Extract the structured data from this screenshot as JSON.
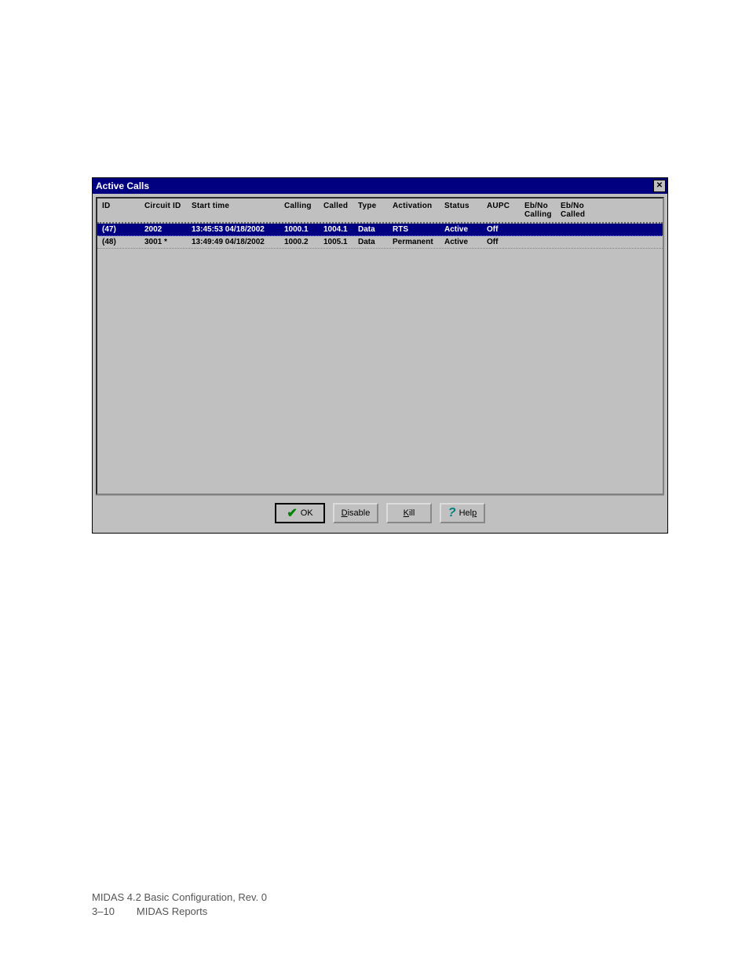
{
  "window": {
    "title": "Active Calls"
  },
  "table": {
    "headers": {
      "id": "ID",
      "circuit_id": "Circuit ID",
      "start_time": "Start time",
      "calling": "Calling",
      "called": "Called",
      "type": "Type",
      "activation": "Activation",
      "status": "Status",
      "aupc": "AUPC",
      "ebno_calling_l1": "Eb/No",
      "ebno_calling_l2": "Calling",
      "ebno_called_l1": "Eb/No",
      "ebno_called_l2": "Called"
    },
    "rows": [
      {
        "id": "(47)",
        "circuit_id": "2002",
        "start_time": "13:45:53 04/18/2002",
        "calling": "1000.1",
        "called": "1004.1",
        "type": "Data",
        "activation": "RTS",
        "status": "Active",
        "aupc": "Off",
        "ebno_calling": "",
        "ebno_called": "",
        "selected": true
      },
      {
        "id": "(48)",
        "circuit_id": "3001 *",
        "start_time": "13:49:49 04/18/2002",
        "calling": "1000.2",
        "called": "1005.1",
        "type": "Data",
        "activation": "Permanent",
        "status": "Active",
        "aupc": "Off",
        "ebno_calling": "",
        "ebno_called": "",
        "selected": false
      }
    ]
  },
  "buttons": {
    "ok": "OK",
    "disable": "Disable",
    "kill": "Kill",
    "help": "Help"
  },
  "footer": {
    "line1": "MIDAS 4.2 Basic Configuration, Rev. 0",
    "line2a": "3–10",
    "line2b": "MIDAS Reports"
  }
}
